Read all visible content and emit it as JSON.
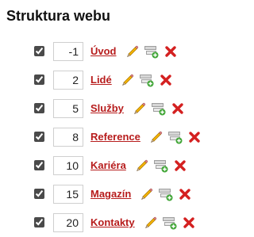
{
  "title": "Struktura webu",
  "items": [
    {
      "order": "-1",
      "label": "Úvod",
      "checked": true
    },
    {
      "order": "2",
      "label": "Lidé",
      "checked": true
    },
    {
      "order": "5",
      "label": "Služby",
      "checked": true
    },
    {
      "order": "8",
      "label": "Reference",
      "checked": true
    },
    {
      "order": "10",
      "label": "Kariéra",
      "checked": true
    },
    {
      "order": "15",
      "label": "Magazín",
      "checked": true
    },
    {
      "order": "20",
      "label": "Kontakty",
      "checked": true
    }
  ],
  "icons": {
    "edit": "pencil-icon",
    "add": "add-subpage-icon",
    "delete": "delete-icon"
  },
  "colors": {
    "link": "#b71c1c",
    "delete": "#d42020",
    "pencil": "#f4b400"
  }
}
